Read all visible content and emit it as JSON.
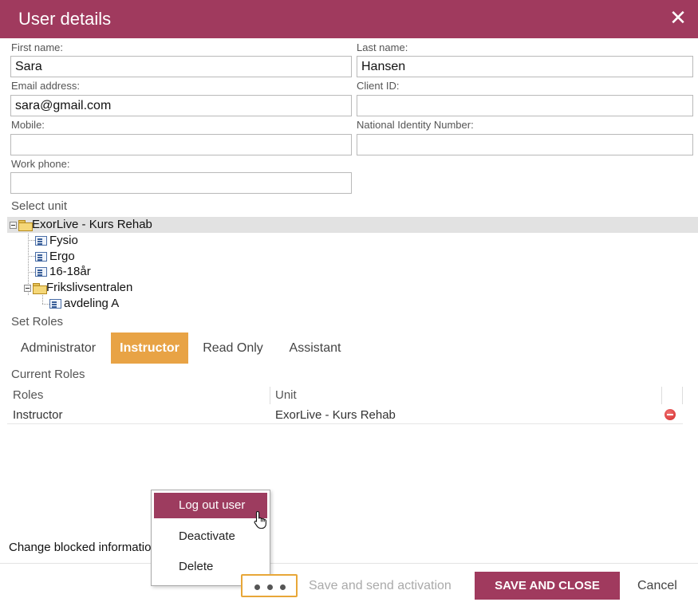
{
  "dialog": {
    "title": "User details"
  },
  "form": {
    "first_name": {
      "label": "First name:",
      "value": "Sara"
    },
    "last_name": {
      "label": "Last name:",
      "value": "Hansen"
    },
    "email": {
      "label": "Email address:",
      "value": "sara@gmail.com"
    },
    "client_id": {
      "label": "Client ID:",
      "value": ""
    },
    "mobile": {
      "label": "Mobile:",
      "value": ""
    },
    "national_id": {
      "label": "National Identity Number:",
      "value": ""
    },
    "work_phone": {
      "label": "Work phone:",
      "value": ""
    }
  },
  "unit_tree": {
    "label": "Select unit",
    "nodes": [
      {
        "label": "ExorLive - Kurs Rehab",
        "type": "folder",
        "expanded": true,
        "selected": true
      },
      {
        "label": "Fysio",
        "type": "unit"
      },
      {
        "label": "Ergo",
        "type": "unit"
      },
      {
        "label": "16-18år",
        "type": "unit"
      },
      {
        "label": "Frikslivsentralen",
        "type": "folder",
        "expanded": true
      },
      {
        "label": "avdeling A",
        "type": "unit"
      }
    ]
  },
  "roles": {
    "label": "Set Roles",
    "tabs": [
      {
        "label": "Administrator",
        "active": false
      },
      {
        "label": "Instructor",
        "active": true
      },
      {
        "label": "Read Only",
        "active": false
      },
      {
        "label": "Assistant",
        "active": false
      }
    ]
  },
  "current_roles": {
    "label": "Current Roles",
    "columns": [
      "Roles",
      "Unit"
    ],
    "rows": [
      {
        "role": "Instructor",
        "unit": "ExorLive - Kurs Rehab"
      }
    ]
  },
  "blocked_info": "Change blocked information",
  "context_menu": {
    "items": [
      {
        "label": "Log out user",
        "hovered": true
      },
      {
        "label": "Deactivate",
        "hovered": false
      },
      {
        "label": "Delete",
        "hovered": false
      }
    ]
  },
  "footer": {
    "more_icon": "three-dots-icon",
    "save_send_label": "Save and send activation",
    "save_close_label": "SAVE AND CLOSE",
    "cancel_label": "Cancel"
  },
  "colors": {
    "brand": "#a03a5e",
    "accent": "#e8a345",
    "menu_hover": "#9d3c5f"
  }
}
